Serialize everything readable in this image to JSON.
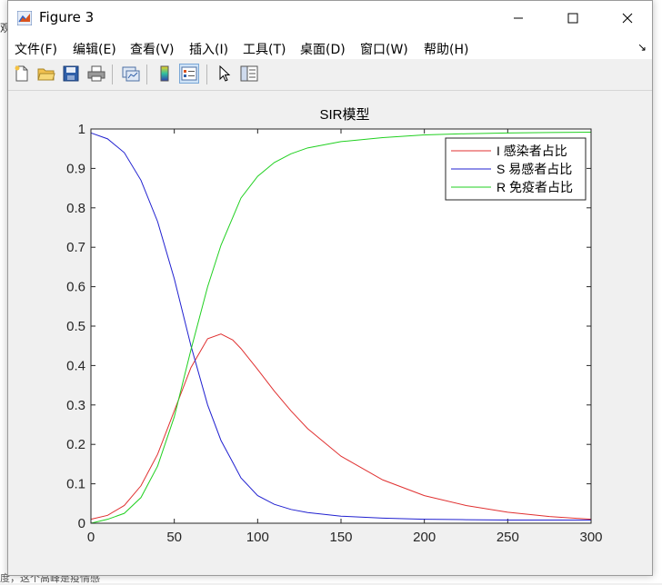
{
  "window": {
    "title": "Figure 3"
  },
  "menu": {
    "items": [
      "文件(F)",
      "编辑(E)",
      "查看(V)",
      "插入(I)",
      "工具(T)",
      "桌面(D)",
      "窗口(W)",
      "帮助(H)"
    ]
  },
  "toolbar": {
    "buttons": [
      "new-figure-icon",
      "open-file-icon",
      "save-icon",
      "print-icon",
      "link-plot-icon",
      "colorbar-icon",
      "legend-icon",
      "pointer-icon",
      "property-editor-icon"
    ]
  },
  "background": {
    "text_top": "观",
    "text_bottom": "度，这个高峰是疫情感"
  },
  "colors": {
    "I": "#e03030",
    "S": "#2020d0",
    "R": "#20d020",
    "axes_bg": "#ffffff"
  },
  "chart_data": {
    "type": "line",
    "title": "SIR模型",
    "xlabel": "",
    "ylabel": "",
    "xlim": [
      0,
      300
    ],
    "ylim": [
      0,
      1
    ],
    "xticks": [
      0,
      50,
      100,
      150,
      200,
      250,
      300
    ],
    "yticks": [
      0,
      0.1,
      0.2,
      0.3,
      0.4,
      0.5,
      0.6,
      0.7,
      0.8,
      0.9,
      1
    ],
    "legend_position": "top-right",
    "grid": false,
    "x": [
      0,
      10,
      20,
      30,
      40,
      50,
      60,
      70,
      78,
      85,
      90,
      100,
      110,
      120,
      130,
      150,
      175,
      200,
      225,
      250,
      275,
      300
    ],
    "series": [
      {
        "name": "I 感染者占比",
        "color": "#e03030",
        "values": [
          0.01,
          0.02,
          0.045,
          0.095,
          0.175,
          0.285,
          0.395,
          0.468,
          0.48,
          0.465,
          0.443,
          0.39,
          0.335,
          0.285,
          0.24,
          0.17,
          0.11,
          0.07,
          0.045,
          0.028,
          0.017,
          0.01
        ]
      },
      {
        "name": "S 易感者占比",
        "color": "#2020d0",
        "values": [
          0.99,
          0.975,
          0.94,
          0.87,
          0.765,
          0.62,
          0.45,
          0.3,
          0.21,
          0.155,
          0.115,
          0.07,
          0.048,
          0.035,
          0.027,
          0.018,
          0.013,
          0.01,
          0.009,
          0.008,
          0.008,
          0.008
        ]
      },
      {
        "name": "R 免疫者占比",
        "color": "#20d020",
        "values": [
          0.0,
          0.01,
          0.025,
          0.065,
          0.145,
          0.27,
          0.44,
          0.6,
          0.705,
          0.775,
          0.825,
          0.88,
          0.915,
          0.937,
          0.952,
          0.968,
          0.978,
          0.985,
          0.988,
          0.99,
          0.991,
          0.992
        ]
      }
    ]
  }
}
